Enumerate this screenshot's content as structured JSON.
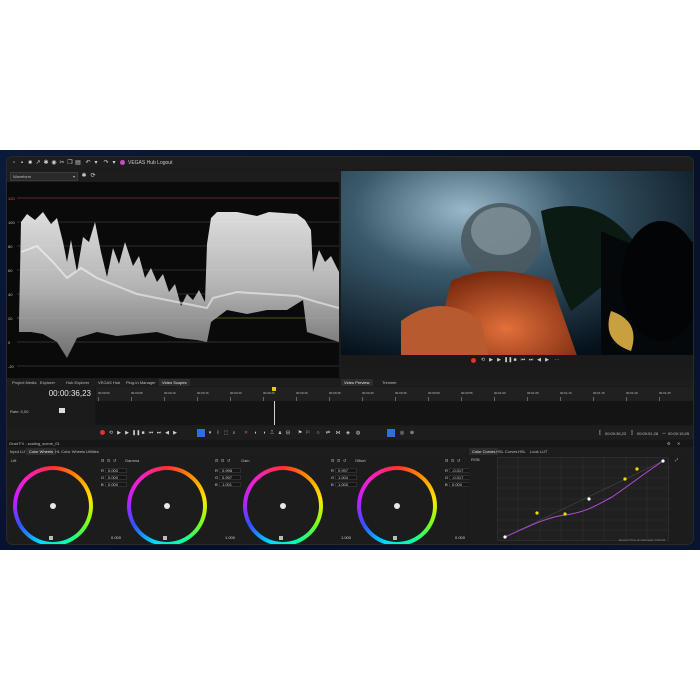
{
  "app": {
    "hub_label": "VEGAS Hub Logout",
    "scope_dropdown": "Waveform"
  },
  "waveform": {
    "ticks": [
      "120",
      "100",
      "80",
      "60",
      "40",
      "20",
      "0",
      "-20"
    ]
  },
  "bottom_tabs": [
    "Project Media",
    "Explorer",
    "Hub Explorer",
    "VEGAS Hub",
    "Plug-In Manager",
    "Video Scopes"
  ],
  "preview_tabs": [
    "Video Preview",
    "Trimmer"
  ],
  "timeline": {
    "timecode": "00:00:36,23",
    "rate_label": "Rate: 0,00",
    "ruler": [
      "00:00:00",
      "00:00:05",
      "00:00:10",
      "00:00:15",
      "00:00:20",
      "00:00:25",
      "00:00:30",
      "00:00:35",
      "00:00:40",
      "00:00:45",
      "00:00:50",
      "00:00:55",
      "00:01:00",
      "00:01:05",
      "00:01:10",
      "00:01:15",
      "00:01:20",
      "00:01:25"
    ],
    "tc_start": "00:00:36,23",
    "tc_end": "00:00:51,28",
    "tc_length": "00:00:15,05"
  },
  "grading": {
    "header": "Grad FX - scaling_scene_01",
    "tabs": [
      "Input LUT",
      "Color Wheels",
      "HL Color Wheels",
      "Utilities"
    ],
    "curve_tabs": [
      "Color Curves",
      "HSL Curves",
      "HSL",
      "Look LUT"
    ],
    "curve_label": "RGB",
    "wheels": [
      {
        "name": "Lift",
        "r": "0.000",
        "g": "0.000",
        "b": "0.000",
        "bottom": "0.000"
      },
      {
        "name": "Gamma",
        "r": "0.998",
        "g": "0.997",
        "b": "1.001",
        "bottom": "1.000"
      },
      {
        "name": "Gain",
        "r": "0.997",
        "g": "1.004",
        "b": "1.000",
        "bottom": "1.000"
      },
      {
        "name": "Offset",
        "r": "-0.017",
        "g": "-0.017",
        "b": "0.000",
        "bottom": "0.000"
      }
    ],
    "channel_labels": [
      "R",
      "G",
      "B"
    ],
    "status": "Record Time (2 channels): 6:06:26"
  },
  "colors": {
    "accent": "#2f6fd6",
    "record": "#e53030",
    "curve": "#b04dd8",
    "curve_point": "#f0e000"
  }
}
